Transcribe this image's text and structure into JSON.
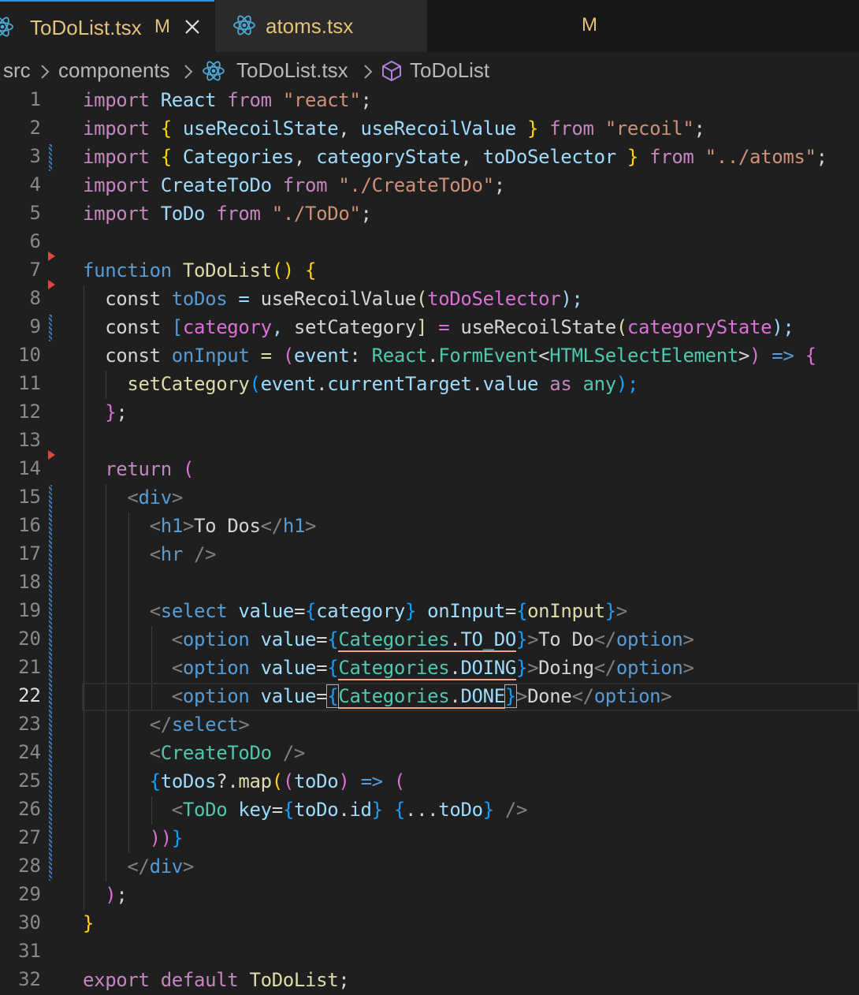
{
  "tabs": [
    {
      "label": "ToDoList.tsx",
      "badge": "M",
      "active": true
    },
    {
      "label": "atoms.tsx",
      "badge": "M",
      "active": false
    }
  ],
  "breadcrumb": [
    "src",
    "components",
    "ToDoList.tsx",
    "ToDoList"
  ],
  "current_line": 22,
  "lines": [
    {
      "n": "1"
    },
    {
      "n": "2"
    },
    {
      "n": "3"
    },
    {
      "n": "4"
    },
    {
      "n": "5"
    },
    {
      "n": "6"
    },
    {
      "n": "7"
    },
    {
      "n": "8"
    },
    {
      "n": "9"
    },
    {
      "n": "10"
    },
    {
      "n": "11"
    },
    {
      "n": "12"
    },
    {
      "n": "13"
    },
    {
      "n": "14"
    },
    {
      "n": "15"
    },
    {
      "n": "16"
    },
    {
      "n": "17"
    },
    {
      "n": "18"
    },
    {
      "n": "19"
    },
    {
      "n": "20"
    },
    {
      "n": "21"
    },
    {
      "n": "22"
    },
    {
      "n": "23"
    },
    {
      "n": "24"
    },
    {
      "n": "25"
    },
    {
      "n": "26"
    },
    {
      "n": "27"
    },
    {
      "n": "28"
    },
    {
      "n": "29"
    },
    {
      "n": "30"
    },
    {
      "n": "31"
    },
    {
      "n": "32"
    }
  ],
  "code": {
    "l1": [
      "import ",
      "React",
      " from ",
      "\"react\"",
      ";"
    ],
    "l2": [
      "import ",
      "{ ",
      "useRecoilState",
      ", ",
      "useRecoilValue",
      " }",
      " from ",
      "\"recoil\"",
      ";"
    ],
    "l3": [
      "import ",
      "{ ",
      "Categories",
      ", ",
      "categoryState",
      ", ",
      "toDoSelector",
      " }",
      " from ",
      "\"../atoms\"",
      ";"
    ],
    "l4": [
      "import ",
      "CreateToDo",
      " from ",
      "\"./CreateToDo\"",
      ";"
    ],
    "l5": [
      "import ",
      "ToDo",
      " from ",
      "\"./ToDo\"",
      ";"
    ],
    "l7": [
      "function ",
      "ToDoList",
      "() ",
      "{"
    ],
    "l8": [
      "  const ",
      "toDos",
      " = ",
      "useRecoilValue",
      "(",
      "toDoSelector",
      ");"
    ],
    "l9": [
      "  const ",
      "[",
      "category",
      ", ",
      "setCategory",
      "]",
      " = ",
      "useRecoilState",
      "(",
      "categoryState",
      ");"
    ],
    "l10": [
      "  const ",
      "onInput",
      " = ",
      "(",
      "event",
      ": ",
      "React",
      ".",
      "FormEvent",
      "<",
      "HTMLSelectElement",
      ">",
      ")",
      " => ",
      "{"
    ],
    "l11": [
      "    ",
      "setCategory",
      "(",
      "event",
      ".",
      "currentTarget",
      ".",
      "value",
      " as ",
      "any",
      ");"
    ],
    "l12": [
      "  ",
      "}",
      ";"
    ],
    "l14": [
      "  ",
      "return ",
      "("
    ],
    "l15": [
      "    ",
      "<",
      "div",
      ">"
    ],
    "l16": [
      "      ",
      "<",
      "h1",
      ">",
      "To Dos",
      "</",
      "h1",
      ">"
    ],
    "l17": [
      "      ",
      "<",
      "hr",
      " />"
    ],
    "l19": [
      "      ",
      "<",
      "select",
      " value",
      "=",
      "{",
      "category",
      "}",
      " onInput",
      "=",
      "{",
      "onInput",
      "}",
      ">"
    ],
    "l20": [
      "        ",
      "<",
      "option",
      " value",
      "=",
      "{",
      "Categories",
      ".",
      "TO_DO",
      "}",
      ">",
      "To Do",
      "</",
      "option",
      ">"
    ],
    "l21": [
      "        ",
      "<",
      "option",
      " value",
      "=",
      "{",
      "Categories",
      ".",
      "DOING",
      "}",
      ">",
      "Doing",
      "</",
      "option",
      ">"
    ],
    "l22": [
      "        ",
      "<",
      "option",
      " value",
      "=",
      "{",
      "Categories",
      ".",
      "DONE",
      "}",
      ">",
      "Done",
      "</",
      "option",
      ">"
    ],
    "l23": [
      "      ",
      "</",
      "select",
      ">"
    ],
    "l24": [
      "      ",
      "<",
      "CreateToDo",
      " />"
    ],
    "l25": [
      "      ",
      "{",
      "toDos",
      "?.",
      "map",
      "(",
      "(",
      "toDo",
      ")",
      " => ",
      "("
    ],
    "l26": [
      "        ",
      "<",
      "ToDo",
      " key",
      "=",
      "{",
      "toDo",
      ".",
      "id",
      "}",
      " {",
      "...",
      "toDo",
      "}",
      " />"
    ],
    "l27": [
      "      ",
      "))",
      "}"
    ],
    "l28": [
      "    ",
      "</",
      "div",
      ">"
    ],
    "l29": [
      "  ",
      ")",
      ";"
    ],
    "l30": [
      "}"
    ],
    "l32": [
      "export ",
      "default ",
      "ToDoList",
      ";"
    ]
  }
}
